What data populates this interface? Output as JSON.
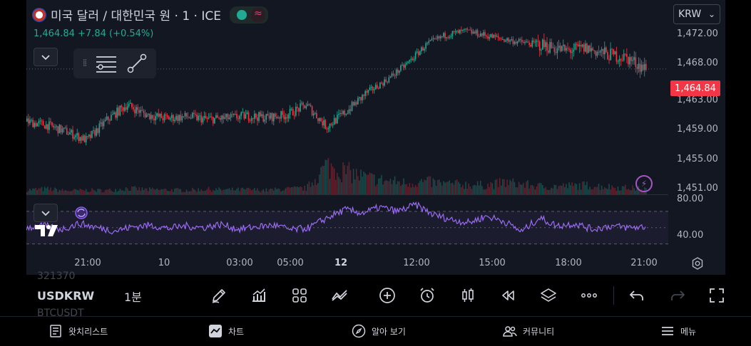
{
  "legend": {
    "symbol_title": "미국 달러 / 대한민국 원 · 1 · ICE",
    "price_change": "1,464.84 +7.84 (+0.54%)",
    "wave_icon": "wave-icon"
  },
  "currency": {
    "label": "KRW",
    "chevron": "⌄"
  },
  "price_axis": {
    "labels": [
      "1,472.00",
      "1,468.00",
      "1,463.00",
      "1,459.00",
      "1,455.00",
      "1,451.00"
    ],
    "current_price": "1,464.84"
  },
  "oscillator_axis": {
    "labels": [
      "80.00",
      "40.00"
    ]
  },
  "time_axis": {
    "labels": [
      "21:00",
      "10",
      "03:00",
      "05:00",
      "12",
      "12:00",
      "15:00",
      "18:00",
      "21:00"
    ]
  },
  "chart_data": [
    {
      "type": "candlestick",
      "ylim": [
        1450,
        1473
      ],
      "x": [
        "21:00",
        "10",
        "03:00",
        "05:00",
        "12",
        "12:00",
        "15:00",
        "18:00",
        "21:00"
      ],
      "close_trend": [
        1458.6,
        1458.2,
        1457.4,
        1456.4,
        1458.8,
        1460.6,
        1459.4,
        1459.0,
        1459.2,
        1458.9,
        1459.0,
        1459.3,
        1459.1,
        1459.4,
        1460.6,
        1458.0,
        1459.8,
        1462.0,
        1463.5,
        1465.4,
        1467.7,
        1468.9,
        1469.3,
        1468.8,
        1468.3,
        1467.9,
        1467.6,
        1467.0,
        1467.3,
        1466.6,
        1466.2,
        1464.84
      ],
      "last_price": 1464.84,
      "colors": {
        "up": "#22ab94",
        "down": "#f23645",
        "price_line": "#f23645"
      }
    },
    {
      "type": "volume",
      "relative_values": [
        0.15,
        0.18,
        0.12,
        0.14,
        0.13,
        0.2,
        0.16,
        0.15,
        0.14,
        0.17,
        0.15,
        0.16,
        0.14,
        0.18,
        0.2,
        0.95,
        0.75,
        0.55,
        0.45,
        0.38,
        0.42,
        0.35,
        0.33,
        0.3,
        0.4,
        0.32,
        0.25,
        0.28,
        0.3,
        0.26,
        0.22,
        0.18
      ]
    },
    {
      "type": "line",
      "ylim": [
        20,
        90
      ],
      "levels": [
        70,
        50,
        30
      ],
      "values": [
        50,
        52,
        48,
        55,
        50,
        46,
        51,
        53,
        49,
        52,
        50,
        54,
        48,
        51,
        53,
        47,
        50,
        62,
        72,
        68,
        75,
        70,
        78,
        66,
        60,
        56,
        64,
        58,
        45,
        62,
        52,
        55,
        48,
        52,
        50,
        51
      ],
      "color": "#9b6bf2"
    }
  ],
  "symbol_bar": {
    "symbol": "USDKRW",
    "interval": "1분",
    "bg_ticker_top": "321370",
    "bg_ticker_bottom": "BTCUSDT"
  },
  "toolbar": {
    "icons": [
      "pencil-icon",
      "indicators-icon",
      "templates-icon",
      "compare-icon",
      "plus-icon",
      "alarm-icon",
      "candles-icon",
      "replay-icon",
      "layers-icon",
      "more-icon",
      "undo-icon",
      "redo-icon",
      "fullscreen-icon"
    ]
  },
  "nav": {
    "watchlist": "왓치리스트",
    "chart": "차트",
    "explore": "알아 보기",
    "community": "커뮤니티",
    "menu": "메뉴"
  }
}
